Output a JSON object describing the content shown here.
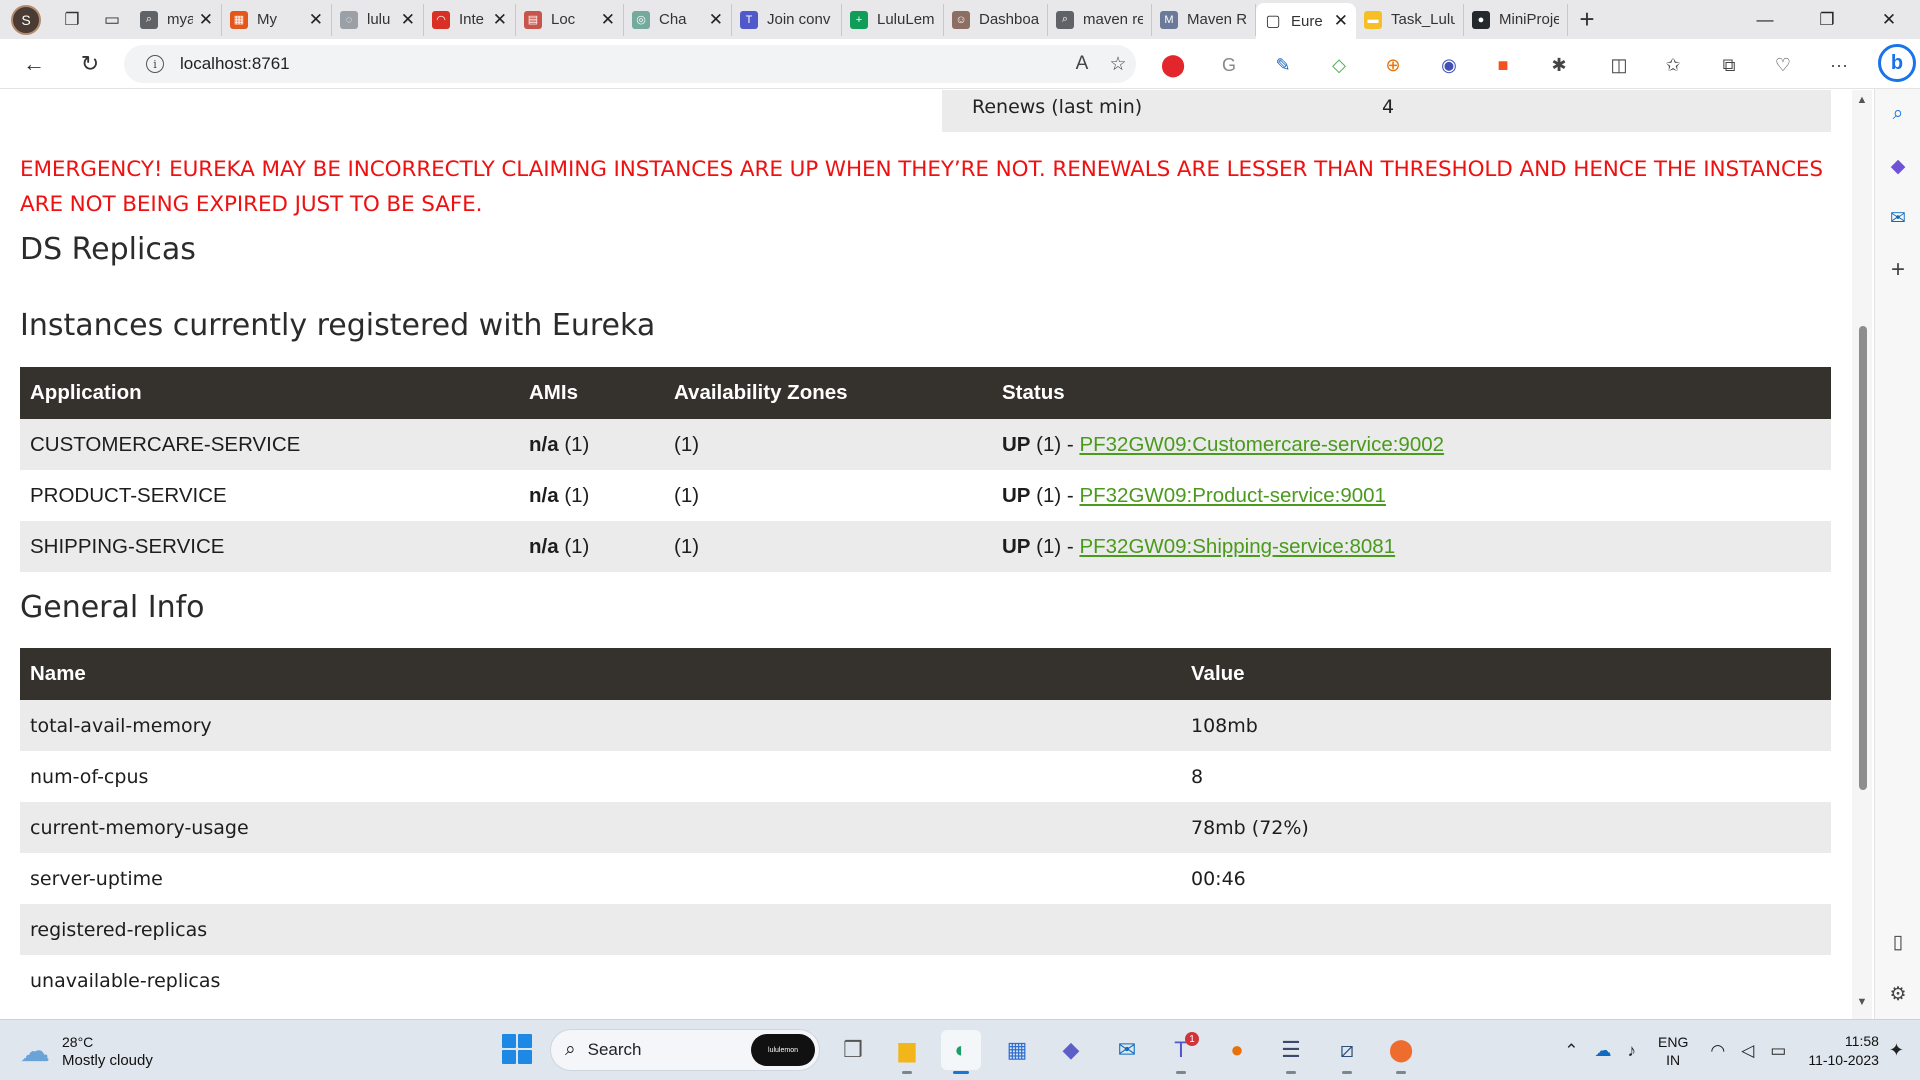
{
  "browser": {
    "profile_initial": "S",
    "tabs": [
      {
        "label": "mya",
        "fav": "#5f6368",
        "glyph": "⌕",
        "w": 90
      },
      {
        "label": "My",
        "fav": "#e4571a",
        "glyph": "▦",
        "w": 110
      },
      {
        "label": "lulu",
        "fav": "#9aa0a6",
        "glyph": "◌",
        "w": 92
      },
      {
        "label": "Inte",
        "fav": "#d93025",
        "glyph": "◠",
        "w": 92
      },
      {
        "label": "Loc",
        "fav": "#c7554b",
        "glyph": "▤",
        "w": 108
      },
      {
        "label": "Cha",
        "fav": "#74aa9c",
        "glyph": "◎",
        "w": 108
      },
      {
        "label": "Join conv",
        "fav": "#5059c9",
        "glyph": "T",
        "w": 110
      },
      {
        "label": "LuluLem",
        "fav": "#0f9d58",
        "glyph": "+",
        "w": 102
      },
      {
        "label": "Dashboa",
        "fav": "#8d6e63",
        "glyph": "☺",
        "w": 104
      },
      {
        "label": "maven re",
        "fav": "#5f6368",
        "glyph": "⌕",
        "w": 104
      },
      {
        "label": "Maven R",
        "fav": "#6b7a99",
        "glyph": "M",
        "w": 104
      }
    ],
    "active_tab": {
      "label": "Eure",
      "glyph": "▢"
    },
    "after_tabs": [
      {
        "label": "Task_Lulu",
        "fav": "#f6bf26",
        "glyph": "▬",
        "w": 108
      },
      {
        "label": "MiniProje",
        "fav": "#24292e",
        "glyph": "●",
        "w": 104
      }
    ],
    "url": "localhost:8761"
  },
  "eureka": {
    "renews_label": "Renews (last min)",
    "renews_value": "4",
    "emergency": "EMERGENCY! EUREKA MAY BE INCORRECTLY CLAIMING INSTANCES ARE UP WHEN THEY’RE NOT. RENEWALS ARE LESSER THAN THRESHOLD AND HENCE THE INSTANCES ARE NOT BEING EXPIRED JUST TO BE SAFE.",
    "ds_replicas_title": "DS Replicas",
    "instances_title": "Instances currently registered with Eureka",
    "instances_headers": [
      "Application",
      "AMIs",
      "Availability Zones",
      "Status"
    ],
    "instances": [
      {
        "app": "CUSTOMERCARE-SERVICE",
        "ami_b": "n/a",
        "ami_n": " (1)",
        "zones": "(1)",
        "status_b": "UP",
        "status_n": " (1) - ",
        "link": "PF32GW09:Customercare-service:9002"
      },
      {
        "app": "PRODUCT-SERVICE",
        "ami_b": "n/a",
        "ami_n": " (1)",
        "zones": "(1)",
        "status_b": "UP",
        "status_n": " (1) - ",
        "link": "PF32GW09:Product-service:9001"
      },
      {
        "app": "SHIPPING-SERVICE",
        "ami_b": "n/a",
        "ami_n": " (1)",
        "zones": "(1)",
        "status_b": "UP",
        "status_n": " (1) - ",
        "link": "PF32GW09:Shipping-service:8081"
      }
    ],
    "general_title": "General Info",
    "general_headers": [
      "Name",
      "Value"
    ],
    "general": [
      {
        "name": "total-avail-memory",
        "value": "108mb"
      },
      {
        "name": "num-of-cpus",
        "value": "8"
      },
      {
        "name": "current-memory-usage",
        "value": "78mb (72%)"
      },
      {
        "name": "server-uptime",
        "value": "00:46"
      },
      {
        "name": "registered-replicas",
        "value": ""
      },
      {
        "name": "unavailable-replicas",
        "value": ""
      }
    ]
  },
  "taskbar": {
    "temp": "28°C",
    "weather": "Mostly cloudy",
    "search_label": "Search",
    "search_badge": "lululemon",
    "lang_1": "ENG",
    "lang_2": "IN",
    "time": "11:58",
    "date": "11-10-2023",
    "teams_badge": "1"
  },
  "colors": {
    "emergency_red": "#ee1111",
    "table_header": "#35312c",
    "link_green": "#4a9a1e",
    "row_stripe": "#ebebeb"
  }
}
